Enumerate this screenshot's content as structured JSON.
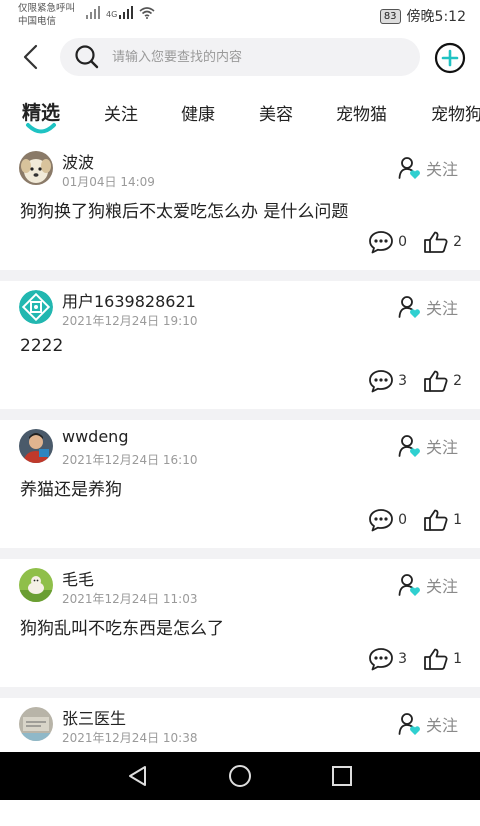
{
  "status_bar": {
    "line1": "仅限紧急呼叫",
    "line2": "中国电信",
    "network": "4G",
    "battery": "83",
    "time": "傍晚5:12"
  },
  "search": {
    "placeholder": "请输入您要查找的内容"
  },
  "tabs": [
    {
      "label": "精选",
      "active": true
    },
    {
      "label": "关注",
      "active": false
    },
    {
      "label": "健康",
      "active": false
    },
    {
      "label": "美容",
      "active": false
    },
    {
      "label": "宠物猫",
      "active": false
    },
    {
      "label": "宠物狗",
      "active": false
    }
  ],
  "posts": [
    {
      "user": "波波",
      "time": "01月04日 14:09",
      "content": "狗狗换了狗粮后不太爱吃怎么办 是什么问题",
      "comments": "0",
      "likes": "2",
      "follow_label": "关注",
      "avatar": "dog-photo"
    },
    {
      "user": "用户1639828621",
      "time": "2021年12月24日 19:10",
      "content": "2222",
      "comments": "3",
      "likes": "2",
      "follow_label": "关注",
      "avatar": "teal-logo"
    },
    {
      "user": "wwdeng",
      "time": "2021年12月24日 16:10",
      "content": "养猫还是养狗",
      "comments": "0",
      "likes": "1",
      "follow_label": "关注",
      "avatar": "person-photo"
    },
    {
      "user": "毛毛",
      "time": "2021年12月24日 11:03",
      "content": "狗狗乱叫不吃东西是怎么了",
      "comments": "3",
      "likes": "1",
      "follow_label": "关注",
      "avatar": "puppy-on-grass"
    },
    {
      "user": "张三医生",
      "time": "2021年12月24日 10:38",
      "content": "",
      "comments": "",
      "likes": "",
      "follow_label": "关注",
      "avatar": "clinic-photo"
    }
  ],
  "colors": {
    "accent": "#1fc3c3",
    "follow_icon_accent": "#2fd0d0",
    "divider": "#f2f2f4"
  }
}
